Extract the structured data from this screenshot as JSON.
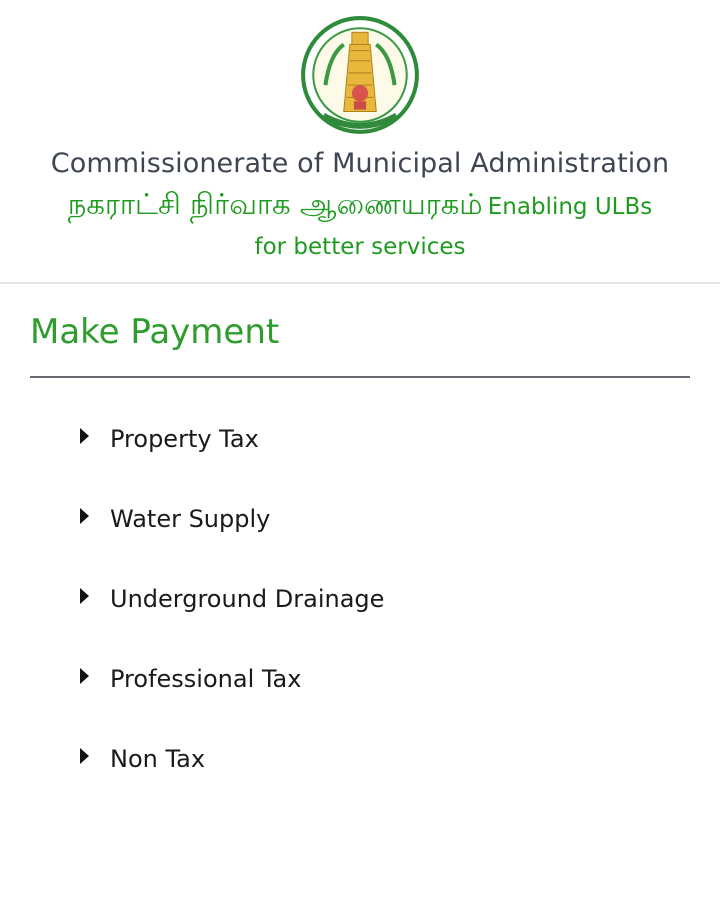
{
  "header": {
    "emblem_icon": "tamil-nadu-emblem-icon",
    "org_title": "Commissionerate of Municipal Administration",
    "tagline_tamil": "நகராட்சி நிர்வாக ஆணையரகம்",
    "tagline_english": "Enabling ULBs for better services"
  },
  "section": {
    "title": "Make Payment"
  },
  "menu": {
    "items": [
      {
        "label": "Property Tax"
      },
      {
        "label": "Water Supply"
      },
      {
        "label": "Underground Drainage"
      },
      {
        "label": "Professional Tax"
      },
      {
        "label": "Non Tax"
      }
    ]
  },
  "colors": {
    "brand_green": "#2e9d2e",
    "title_gray": "#3e4652",
    "divider": "#666a70"
  }
}
